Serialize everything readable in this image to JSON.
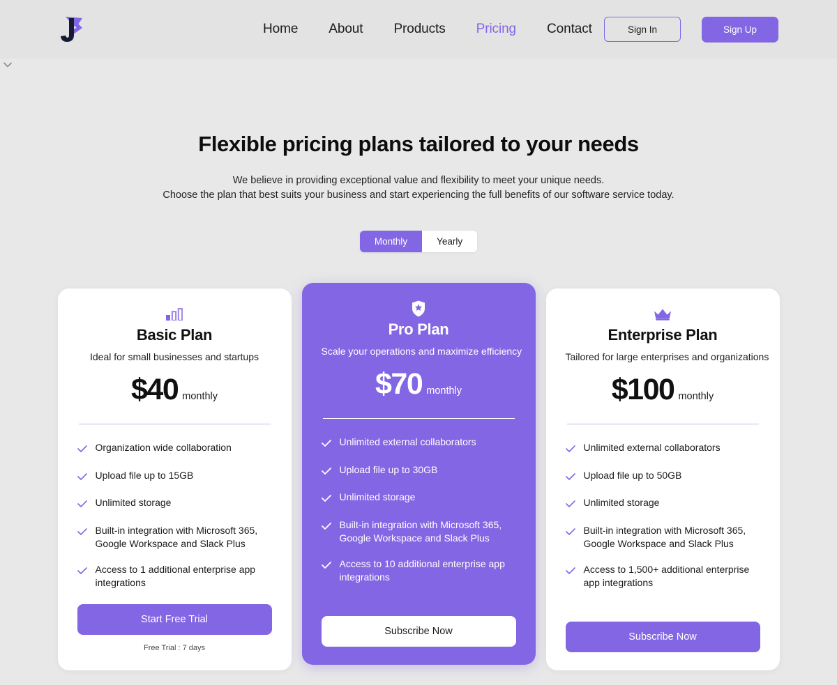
{
  "header": {
    "logo_alt": "J logo",
    "nav": [
      {
        "label": "Home",
        "active": false
      },
      {
        "label": "About",
        "active": false
      },
      {
        "label": "Products",
        "active": false
      },
      {
        "label": "Pricing",
        "active": true
      },
      {
        "label": "Contact",
        "active": false
      }
    ],
    "sign_in_label": "Sign In",
    "sign_up_label": "Sign Up",
    "accent_color": "#8366e4",
    "background_color": "#e3e3e3"
  },
  "scroll_hint_icon": "chevron-down-icon",
  "hero": {
    "title": "Flexible pricing plans tailored to your needs",
    "subtitle_line1": "We believe in providing exceptional value and flexibility to meet your unique needs.",
    "subtitle_line2": "Choose the plan that best suits your business and start experiencing the full benefits of our software service today."
  },
  "billing_toggle": {
    "options": [
      {
        "label": "Monthly",
        "selected": true
      },
      {
        "label": "Yearly",
        "selected": false
      }
    ]
  },
  "plans": [
    {
      "icon": "bar-chart-icon",
      "name": "Basic Plan",
      "description": "Ideal for small businesses and startups",
      "price": "$40",
      "period": "monthly",
      "features": [
        "Organization wide collaboration",
        "Upload file up to 15GB",
        "Unlimited storage",
        "Built-in integration with Microsoft 365, Google Workspace and Slack Plus",
        "Access to 1 additional enterprise app integrations"
      ],
      "cta_label": "Start Free Trial",
      "footnote": "Free Trial : 7 days",
      "featured": false
    },
    {
      "icon": "shield-star-icon",
      "name": "Pro Plan",
      "description": "Scale your operations and maximize efficiency",
      "price": "$70",
      "period": "monthly",
      "features": [
        "Unlimited external collaborators",
        "Upload file up to 30GB",
        "Unlimited storage",
        "Built-in integration with Microsoft 365, Google Workspace and Slack Plus",
        "Access to 10 additional enterprise app integrations"
      ],
      "cta_label": "Subscribe Now",
      "footnote": "",
      "featured": true
    },
    {
      "icon": "crown-icon",
      "name": "Enterprise Plan",
      "description": "Tailored for large enterprises and organizations",
      "price": "$100",
      "period": "monthly",
      "features": [
        "Unlimited external collaborators",
        "Upload file up to 50GB",
        "Unlimited storage",
        "Built-in integration with Microsoft 365, Google Workspace and Slack Plus",
        "Access to 1,500+ additional enterprise app integrations"
      ],
      "cta_label": "Subscribe Now",
      "footnote": "",
      "featured": false
    }
  ]
}
